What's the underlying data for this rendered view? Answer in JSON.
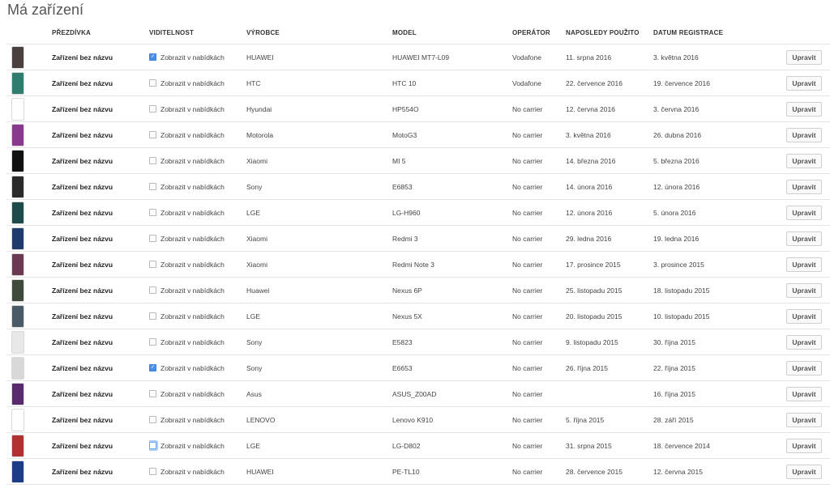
{
  "page": {
    "title": "Má zařízení"
  },
  "columns": {
    "thumb": "PŘEZDÍVKA",
    "visibility": "VIDITELNOST",
    "manufacturer": "VÝROBCE",
    "model": "MODEL",
    "operator": "OPERÁTOR",
    "last_used": "NAPOSLEDY POUŽITO",
    "registered": "DATUM REGISTRACE"
  },
  "edit_label": "Upravit",
  "visibility_label": "Zobrazit v nabídkách",
  "rows": [
    {
      "name": "Zařízení bez názvu",
      "visible": true,
      "focus": false,
      "manufacturer": "HUAWEI",
      "model": "HUAWEI MT7-L09",
      "operator": "Vodafone",
      "last_used": "11. srpna 2016",
      "registered": "3. května 2016",
      "thumb_color": "#4a4040"
    },
    {
      "name": "Zařízení bez názvu",
      "visible": false,
      "focus": false,
      "manufacturer": "HTC",
      "model": "HTC 10",
      "operator": "Vodafone",
      "last_used": "22. července 2016",
      "registered": "19. července 2016",
      "thumb_color": "#2f7d6e"
    },
    {
      "name": "Zařízení bez názvu",
      "visible": false,
      "focus": false,
      "manufacturer": "Hyundai",
      "model": "HP554O",
      "operator": "No carrier",
      "last_used": "12. června 2016",
      "registered": "3. června 2016",
      "thumb_color": "#ffffff"
    },
    {
      "name": "Zařízení bez názvu",
      "visible": false,
      "focus": false,
      "manufacturer": "Motorola",
      "model": "MotoG3",
      "operator": "No carrier",
      "last_used": "3. května 2016",
      "registered": "26. dubna 2016",
      "thumb_color": "#8a3a8e"
    },
    {
      "name": "Zařízení bez názvu",
      "visible": false,
      "focus": false,
      "manufacturer": "Xiaomi",
      "model": "MI 5",
      "operator": "No carrier",
      "last_used": "14. března 2016",
      "registered": "5. března 2016",
      "thumb_color": "#111111"
    },
    {
      "name": "Zařízení bez názvu",
      "visible": false,
      "focus": false,
      "manufacturer": "Sony",
      "model": "E6853",
      "operator": "No carrier",
      "last_used": "14. února 2016",
      "registered": "12. února 2016",
      "thumb_color": "#2a2a2a"
    },
    {
      "name": "Zařízení bez názvu",
      "visible": false,
      "focus": false,
      "manufacturer": "LGE",
      "model": "LG-H960",
      "operator": "No carrier",
      "last_used": "12. února 2016",
      "registered": "5. února 2016",
      "thumb_color": "#1d4a4a"
    },
    {
      "name": "Zařízení bez názvu",
      "visible": false,
      "focus": false,
      "manufacturer": "Xiaomi",
      "model": "Redmi 3",
      "operator": "No carrier",
      "last_used": "29. ledna 2016",
      "registered": "19. ledna 2016",
      "thumb_color": "#1f3b6e"
    },
    {
      "name": "Zařízení bez názvu",
      "visible": false,
      "focus": false,
      "manufacturer": "Xiaomi",
      "model": "Redmi Note 3",
      "operator": "No carrier",
      "last_used": "17. prosince 2015",
      "registered": "3. prosince 2015",
      "thumb_color": "#6b3a52"
    },
    {
      "name": "Zařízení bez názvu",
      "visible": false,
      "focus": false,
      "manufacturer": "Huawei",
      "model": "Nexus 6P",
      "operator": "No carrier",
      "last_used": "25. listopadu 2015",
      "registered": "18. listopadu 2015",
      "thumb_color": "#3e4a3a"
    },
    {
      "name": "Zařízení bez názvu",
      "visible": false,
      "focus": false,
      "manufacturer": "LGE",
      "model": "Nexus 5X",
      "operator": "No carrier",
      "last_used": "20. listopadu 2015",
      "registered": "10. listopadu 2015",
      "thumb_color": "#4a5a66"
    },
    {
      "name": "Zařízení bez názvu",
      "visible": false,
      "focus": false,
      "manufacturer": "Sony",
      "model": "E5823",
      "operator": "No carrier",
      "last_used": "9. listopadu 2015",
      "registered": "30. října 2015",
      "thumb_color": "#e8e8e8"
    },
    {
      "name": "Zařízení bez názvu",
      "visible": true,
      "focus": false,
      "manufacturer": "Sony",
      "model": "E6653",
      "operator": "No carrier",
      "last_used": "26. října 2015",
      "registered": "22. října 2015",
      "thumb_color": "#d8d8d8"
    },
    {
      "name": "Zařízení bez názvu",
      "visible": false,
      "focus": false,
      "manufacturer": "Asus",
      "model": "ASUS_Z00AD",
      "operator": "No carrier",
      "last_used": "",
      "registered": "16. října 2015",
      "thumb_color": "#5a2a6e"
    },
    {
      "name": "Zařízení bez názvu",
      "visible": false,
      "focus": false,
      "manufacturer": "LENOVO",
      "model": "Lenovo K910",
      "operator": "No carrier",
      "last_used": "5. října 2015",
      "registered": "28. září 2015",
      "thumb_color": "#ffffff"
    },
    {
      "name": "Zařízení bez názvu",
      "visible": false,
      "focus": true,
      "manufacturer": "LGE",
      "model": "LG-D802",
      "operator": "No carrier",
      "last_used": "31. srpna 2015",
      "registered": "18. července 2014",
      "thumb_color": "#b23030"
    },
    {
      "name": "Zařízení bez názvu",
      "visible": false,
      "focus": false,
      "manufacturer": "HUAWEI",
      "model": "PE-TL10",
      "operator": "No carrier",
      "last_used": "28. července 2015",
      "registered": "12. června 2015",
      "thumb_color": "#1c3c8a"
    }
  ]
}
